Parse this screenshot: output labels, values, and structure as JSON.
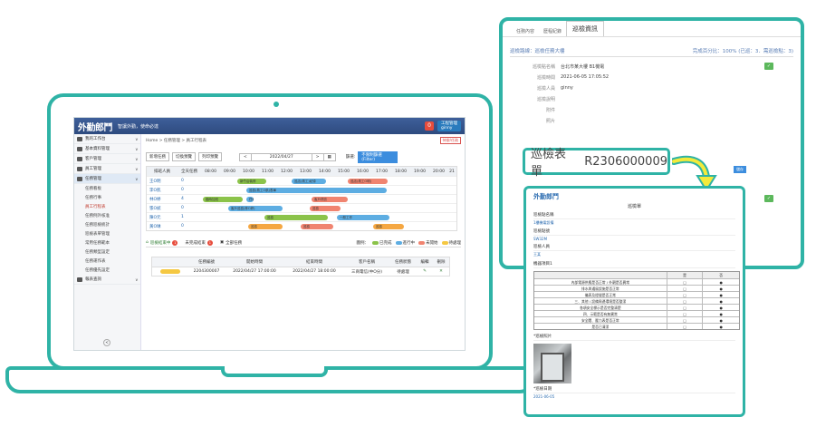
{
  "app": {
    "logo": "外勤郎鬥",
    "slogan": "智讓外勤，使命必達",
    "notification_count": "0",
    "user_lines": [
      "工程管理",
      "ginny"
    ]
  },
  "sidebar": {
    "items": [
      {
        "label": "我的工作台"
      },
      {
        "label": "基本資料管理"
      },
      {
        "label": "客戶管理"
      },
      {
        "label": "員工管理"
      },
      {
        "label": "任務管理"
      }
    ],
    "subitems": [
      "任務看板",
      "任務行事",
      "員工行程表",
      "任務例外核准",
      "任務巡檢統計",
      "巡檢表單管理",
      "常用任務範本",
      "任務類型設定",
      "任務運作表",
      "任務優先設定"
    ],
    "bottom_item": "報表查詢",
    "collapse_icon": "<"
  },
  "main": {
    "breadcrumb": "Home > 任務管理 > 員工行程表",
    "breadcrumb_button": "待辦/任務",
    "toolbar": {
      "new_task": "新增任務",
      "toggle1": "切換預覽",
      "toggle2": "列印預覽",
      "date": "2022/04/27",
      "prev": "<",
      "next": ">",
      "calendar_icon": "▦",
      "filter_label": "篩選:",
      "filter_value": "不限制篩選(Filter)"
    },
    "grid_header": [
      "排班人員",
      "全天任務",
      "08:00",
      "09:00",
      "10:00",
      "11:00",
      "12:00",
      "13:00",
      "14:00",
      "15:00",
      "16:00",
      "17:00",
      "18:00",
      "19:00",
      "20:00",
      "21"
    ],
    "grid_rows": [
      {
        "name": "王O明",
        "count": "0"
      },
      {
        "name": "李O凱",
        "count": "0"
      },
      {
        "name": "林O婷",
        "count": "4"
      },
      {
        "name": "張O斌",
        "count": "0"
      },
      {
        "name": "陳O元",
        "count": "1"
      },
      {
        "name": "黃O琳",
        "count": "0"
      }
    ],
    "bars": [
      "新竹店裝修",
      "巡店(員工O明)",
      "巡店(員工)紀錄",
      "巡檢(員工O凱)表單",
      "客戶拜訪",
      "臨時加班",
      "任務",
      "客戶巡檢(林O婷)",
      "巡檢",
      "巡檢",
      "一般工作",
      "巡檢",
      "巡檢",
      "巡檢",
      "巡店"
    ],
    "bottom_tabs": [
      {
        "label": "巡檢結束中",
        "badge": "1"
      },
      {
        "label": "未完成結束",
        "badge": "1"
      },
      {
        "label": "全部任務",
        "badge": ""
      }
    ],
    "legend_label": "圖例：",
    "legend": [
      {
        "label": "已完成",
        "color": "#8bc34a"
      },
      {
        "label": "進行中",
        "color": "#5dade2"
      },
      {
        "label": "未開始",
        "color": "#f08470"
      },
      {
        "label": "待處理",
        "color": "#f5c842"
      }
    ],
    "table_headers": [
      "",
      "任務編號",
      "開始時間",
      "結束時間",
      "客戶名稱",
      "任務狀態",
      "編輯",
      "刪除"
    ],
    "table_row": [
      "",
      "2204300007",
      "2022/04/27 17:00:00",
      "2022/04/27 18:00:00",
      "三商電信(中O分)",
      "待處理",
      "✎",
      "✕"
    ]
  },
  "panel": {
    "tabs": [
      "任務內容",
      "歷程紀錄",
      "巡檢資訊"
    ],
    "route_label": "巡檢路線：",
    "route_value": "巡檢任務大樓",
    "completion": "完成百分比：100% (已巡：3．需巡檢點：3)",
    "rows": [
      {
        "key": "巡檢點名稱",
        "value": "台北市某大樓 B1機電"
      },
      {
        "key": "巡檢時間",
        "value": "2021-06-05 17:05:52"
      },
      {
        "key": "巡檢人員",
        "value": "ginny"
      },
      {
        "key": "巡檢說明",
        "value": ""
      },
      {
        "key": "附件",
        "value": ""
      },
      {
        "key": "照片",
        "value": ""
      }
    ],
    "ok_icon": "✓",
    "save_label": "儲存"
  },
  "highlight": {
    "label": "巡檢表單",
    "code": "R2306000009"
  },
  "form_doc": {
    "logo": "外勤郎鬥",
    "title": "巡檢單",
    "sections": [
      {
        "title": "巡檢點名稱",
        "value": "1樓機電設備"
      },
      {
        "title": "巡檢點號",
        "value": "SW32M"
      },
      {
        "title": "巡檢人員",
        "value": "王某"
      }
    ],
    "table_title": "機器項目1",
    "table_head": [
      "",
      "是",
      "否"
    ],
    "table_rows": [
      [
        "內部電源供應是否正常 / 外觀是否異常",
        "□",
        "●"
      ],
      [
        "排水與通風設施是否正常",
        "□",
        "●"
      ],
      [
        "儀表及燈號是否正常",
        "□",
        "●"
      ],
      [
        "三、其他 / 設備周邊環境是否整潔",
        "□",
        "●"
      ],
      [
        "各項安全標示是否完整清楚",
        "□",
        "●"
      ],
      [
        "四、示範是否有無異常",
        "□",
        "●"
      ],
      [
        "安全閥、壓力表是否正常",
        "□",
        "●"
      ],
      [
        "是否已清潔",
        "□",
        "●"
      ]
    ],
    "photo_label": "*巡檢照片",
    "date_label": "*巡檢日期",
    "date_value": "2021-06-05"
  }
}
